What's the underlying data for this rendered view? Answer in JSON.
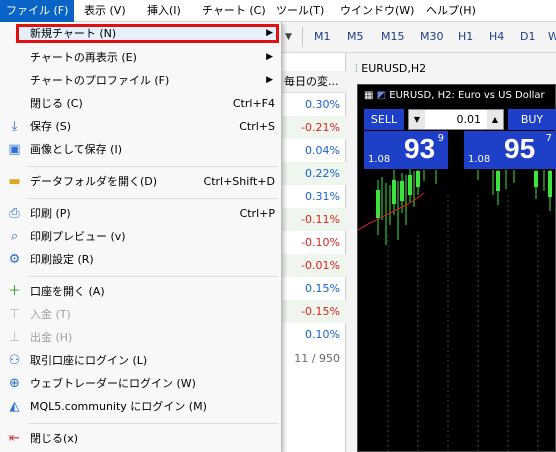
{
  "menubar": {
    "items": [
      {
        "label": "ファイル (F)"
      },
      {
        "label": "表示 (V)"
      },
      {
        "label": "挿入(I)"
      },
      {
        "label": "チャート (C)"
      },
      {
        "label": "ツール(T)"
      },
      {
        "label": "ウインドウ(W)"
      },
      {
        "label": "ヘルプ(H)"
      }
    ]
  },
  "toolbar": {
    "timeframes": [
      "M1",
      "M5",
      "M15",
      "M30",
      "H1",
      "H4",
      "D1",
      "W"
    ]
  },
  "market_watch": {
    "header": "毎日の変...",
    "changes": [
      "0.30%",
      "-0.21%",
      "0.04%",
      "0.22%",
      "0.31%",
      "-0.11%",
      "-0.10%",
      "-0.01%",
      "0.15%",
      "-0.15%",
      "0.10%"
    ],
    "count": "11 / 950"
  },
  "chart": {
    "tab_title": "EURUSD,H2",
    "header_symbol": "EURUSD, H2:",
    "header_desc": "Euro vs US Dollar",
    "sell_label": "SELL",
    "buy_label": "BUY",
    "lot": "0.01",
    "sell_price_prefix": "1.08",
    "sell_price_big": "93",
    "sell_price_sup": "9",
    "buy_price_prefix": "1.08",
    "buy_price_big": "95",
    "buy_price_sup": "7",
    "colors": {
      "background": "#000000",
      "candles": "#3ee43e",
      "ma": "#e02020",
      "panel": "#1e3fc8"
    }
  },
  "file_menu": {
    "new_chart": "新規チャート (N)",
    "reopen_chart": "チャートの再表示 (E)",
    "chart_profile": "チャートのプロファイル (F)",
    "close": "閉じる (C)",
    "close_sc": "Ctrl+F4",
    "save": "保存 (S)",
    "save_sc": "Ctrl+S",
    "save_image": "画像として保存 (I)",
    "open_data_folder": "データフォルダを開く(D)",
    "open_data_folder_sc": "Ctrl+Shift+D",
    "print": "印刷 (P)",
    "print_sc": "Ctrl+P",
    "print_preview": "印刷プレビュー (v)",
    "print_setup": "印刷設定 (R)",
    "open_account": "口座を開く (A)",
    "deposit": "入金 (T)",
    "withdraw": "出金 (H)",
    "login_trade": "取引口座にログイン (L)",
    "login_webtrader": "ウェブトレーダーにログイン (W)",
    "login_mql5": "MQL5.community にログイン (M)",
    "exit": "閉じる(x)"
  }
}
